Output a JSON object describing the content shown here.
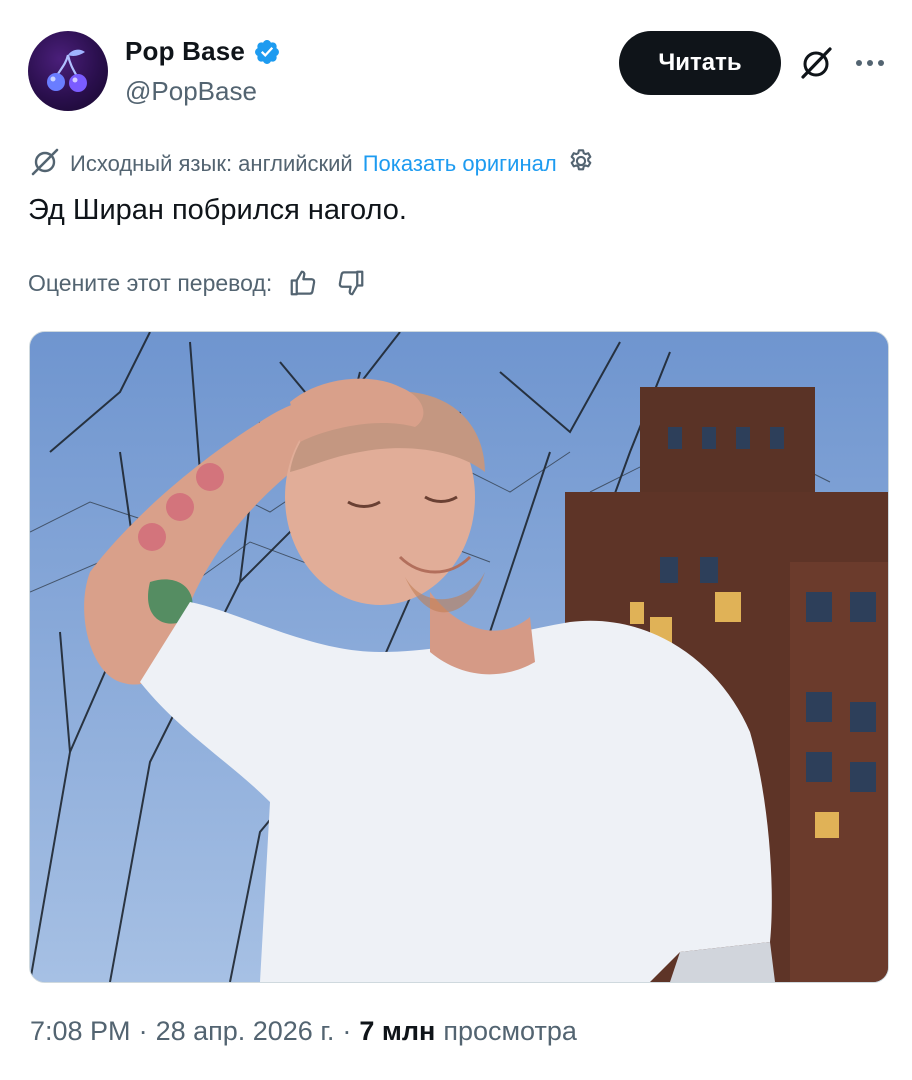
{
  "account": {
    "display_name": "Pop Base",
    "handle": "@PopBase",
    "verified_icon": "verified-badge-icon",
    "avatar_icon": "cherries-icon"
  },
  "actions": {
    "follow_label": "Читать",
    "grok_icon": "grok-icon",
    "more_icon": "more-icon"
  },
  "translation": {
    "source_text": "Исходный язык: английский",
    "show_original_label": "Показать оригинал",
    "settings_icon": "gear-icon"
  },
  "tweet": {
    "text": "Эд Ширан побрился наголо."
  },
  "rating": {
    "prompt": "Оцените этот перевод:",
    "like_icon": "thumbs-up-icon",
    "dislike_icon": "thumbs-down-icon"
  },
  "footer": {
    "time": "7:08 PM",
    "sep1": "·",
    "date": "28 апр. 2026 г.",
    "sep2": "·",
    "views_count": "7 млн",
    "views_label": "просмотра"
  },
  "colors": {
    "accent": "#1d9bf0",
    "text": "#0f1419",
    "muted": "#536471",
    "button": "#0f1419"
  }
}
